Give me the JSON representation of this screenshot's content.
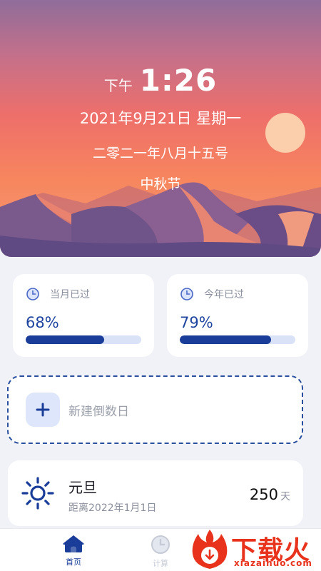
{
  "hero": {
    "ampm": "下午",
    "time": "1:26",
    "date": "2021年9月21日  星期一",
    "lunar_date": "二零二一年八月十五号",
    "festival": "中秋节"
  },
  "progress": [
    {
      "title": "当月已过",
      "value_text": "68%",
      "fraction": 0.68,
      "icon": "clock-icon"
    },
    {
      "title": "今年已过",
      "value_text": "79%",
      "fraction": 0.79,
      "icon": "clock-icon"
    }
  ],
  "new_countdown": {
    "label": "新建倒数日",
    "icon": "plus-icon"
  },
  "holiday": {
    "name": "元旦",
    "target": "距离2022年1月1日",
    "days": "250",
    "unit": "天",
    "icon": "sun-icon"
  },
  "tabbar": {
    "items": [
      {
        "label": "首页",
        "icon": "home-icon",
        "active": true
      },
      {
        "label": "计算",
        "icon": "clock-icon",
        "active": false
      }
    ]
  },
  "watermark": {
    "text": "下载火",
    "sub": "xiazaihuo.com"
  },
  "colors": {
    "accent": "#1a3d99",
    "bar_bg": "#d9e2f7",
    "page_bg": "#f0f2f8",
    "watermark": "#e8321c"
  }
}
